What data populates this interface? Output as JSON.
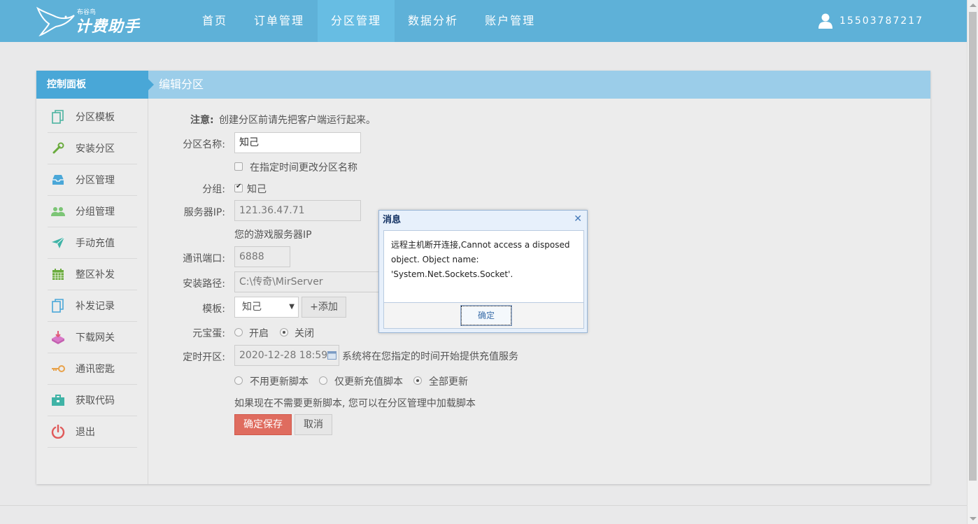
{
  "app": {
    "logo_small": "布谷鸟",
    "logo_text": "计费助手"
  },
  "nav": {
    "items": [
      {
        "label": "首页"
      },
      {
        "label": "订单管理"
      },
      {
        "label": "分区管理"
      },
      {
        "label": "数据分析"
      },
      {
        "label": "账户管理"
      }
    ],
    "active": "分区管理"
  },
  "user": {
    "phone": "15503787217"
  },
  "panel": {
    "control_label": "控制面板",
    "title": "编辑分区"
  },
  "sidebar": {
    "items": [
      {
        "label": "分区模板",
        "icon": "copy-icon"
      },
      {
        "label": "安装分区",
        "icon": "wrench-icon"
      },
      {
        "label": "分区管理",
        "icon": "inbox-icon"
      },
      {
        "label": "分组管理",
        "icon": "users-icon"
      },
      {
        "label": "手动充值",
        "icon": "send-icon"
      },
      {
        "label": "整区补发",
        "icon": "calendar-icon"
      },
      {
        "label": "补发记录",
        "icon": "copy-icon"
      },
      {
        "label": "下载网关",
        "icon": "download-icon"
      },
      {
        "label": "通讯密匙",
        "icon": "key-icon"
      },
      {
        "label": "获取代码",
        "icon": "briefcase-icon"
      },
      {
        "label": "退出",
        "icon": "power-icon"
      }
    ]
  },
  "form": {
    "notice_label": "注意:",
    "notice_text": "创建分区前请先把客户端运行起来。",
    "name_label": "分区名称:",
    "name_value": "知己",
    "rename_checkbox_label": "在指定时间更改分区名称",
    "group_label": "分组:",
    "group_checkbox_label": "知己",
    "server_ip_label": "服务器IP:",
    "server_ip_value": "121.36.47.71",
    "server_ip_hint": "您的游戏服务器IP",
    "port_label": "通讯端口:",
    "port_value": "6888",
    "path_label": "安装路径:",
    "path_value": "C:\\传奇\\MirServer",
    "template_label": "模板:",
    "template_value": "知己",
    "add_button": "+添加",
    "yuanbao_label": "元宝蛋:",
    "yuanbao_on": "开启",
    "yuanbao_off": "关闭",
    "schedule_label": "定时开区:",
    "schedule_value": "2020-12-28 18:59",
    "schedule_hint": "系统将在您指定的时间开始提供充值服务",
    "update_options": [
      "不用更新脚本",
      "仅更新充值脚本",
      "全部更新"
    ],
    "update_hint": "如果现在不需要更新脚本, 您可以在分区管理中加载脚本",
    "save_button": "确定保存",
    "cancel_button": "取消"
  },
  "dialog": {
    "title": "消息",
    "message": "远程主机断开连接,Cannot access a disposed object. Object name: 'System.Net.Sockets.Socket'.",
    "ok_button": "确定"
  },
  "colors": {
    "header": "#5eb1d8",
    "accent": "#49a7d7",
    "panel_head": "#9bcde9",
    "primary_button": "#df6c5f"
  }
}
